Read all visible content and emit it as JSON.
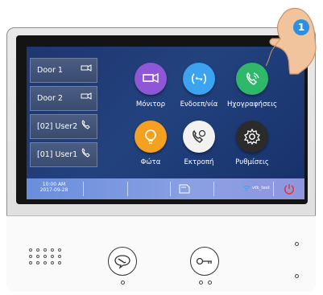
{
  "doors": [
    {
      "label": "Door 1",
      "icon": "camera-icon"
    },
    {
      "label": "Door 2",
      "icon": "camera-icon"
    },
    {
      "label": "[02] User2",
      "icon": "phone-icon"
    },
    {
      "label": "[01] User1",
      "icon": "phone-icon"
    }
  ],
  "apps": [
    {
      "label": "Μόνιτορ",
      "icon": "camera-icon",
      "color": "#8e57d6"
    },
    {
      "label": "Ενδοεπ/νία",
      "icon": "intercom-icon",
      "color": "#3ba3f0"
    },
    {
      "label": "Ηχογραφήσεις",
      "icon": "phone-call-icon",
      "color": "#2fb86a"
    },
    {
      "label": "Φώτα",
      "icon": "bulb-icon",
      "color": "#f4a020"
    },
    {
      "label": "Εκτροπή",
      "icon": "call-forward-icon",
      "color": "#f2f2f2"
    },
    {
      "label": "Ρυθμίσεις",
      "icon": "gear-icon",
      "color": "#2b2b2b"
    }
  ],
  "status": {
    "time": "10:00 AM",
    "date": "2017-09-28",
    "wifi_name": "vtk_test"
  },
  "step_badge": "1",
  "colors": {
    "screen_bg": "#1f3570",
    "status_bar": "#7a96de",
    "power_red": "#e53935",
    "badge_blue": "#2d8fe0"
  }
}
